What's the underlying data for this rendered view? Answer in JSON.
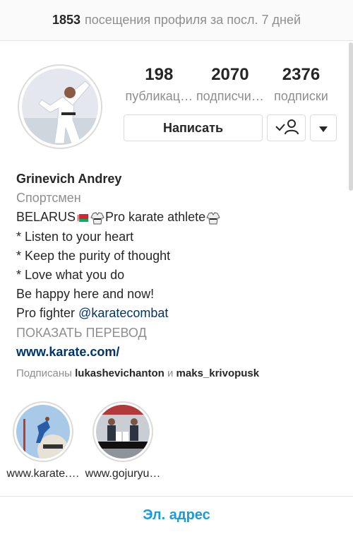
{
  "visits": {
    "count": "1853",
    "text": "посещения профиля за посл. 7 дней"
  },
  "stats": [
    {
      "value": "198",
      "label": "публикац…"
    },
    {
      "value": "2070",
      "label": "подписчи…"
    },
    {
      "value": "2376",
      "label": "подписки"
    }
  ],
  "actions": {
    "message_label": "Написать"
  },
  "icons": {
    "follow": "person-check-icon",
    "more": "chevron-down-icon"
  },
  "bio": {
    "name": "Grinevich Andrey",
    "category": "Спортсмен",
    "line1_prefix": "BELARUS",
    "line1_text": "Pro karate athlete",
    "line2": "* Listen to your heart",
    "line3": "* Keep the purity of thought",
    "line4": "* Love what you do",
    "line5": "Be happy here and now!",
    "line6_prefix": "Pro fighter ",
    "mention": "@karatecombat",
    "translate": "ПОКАЗАТЬ ПЕРЕВОД",
    "website": "www.karate.com/"
  },
  "followed_by": {
    "prefix": "Подписаны ",
    "user1": "lukashevichanton",
    "sep": " и ",
    "user2": "maks_krivopusk"
  },
  "highlights": [
    {
      "label": "www.karate.…"
    },
    {
      "label": "www.gojuryu…"
    }
  ],
  "email_label": "Эл. адрес",
  "colors": {
    "link": "#003569",
    "accent": "#1a9cdc",
    "muted": "#8e8e8e"
  }
}
